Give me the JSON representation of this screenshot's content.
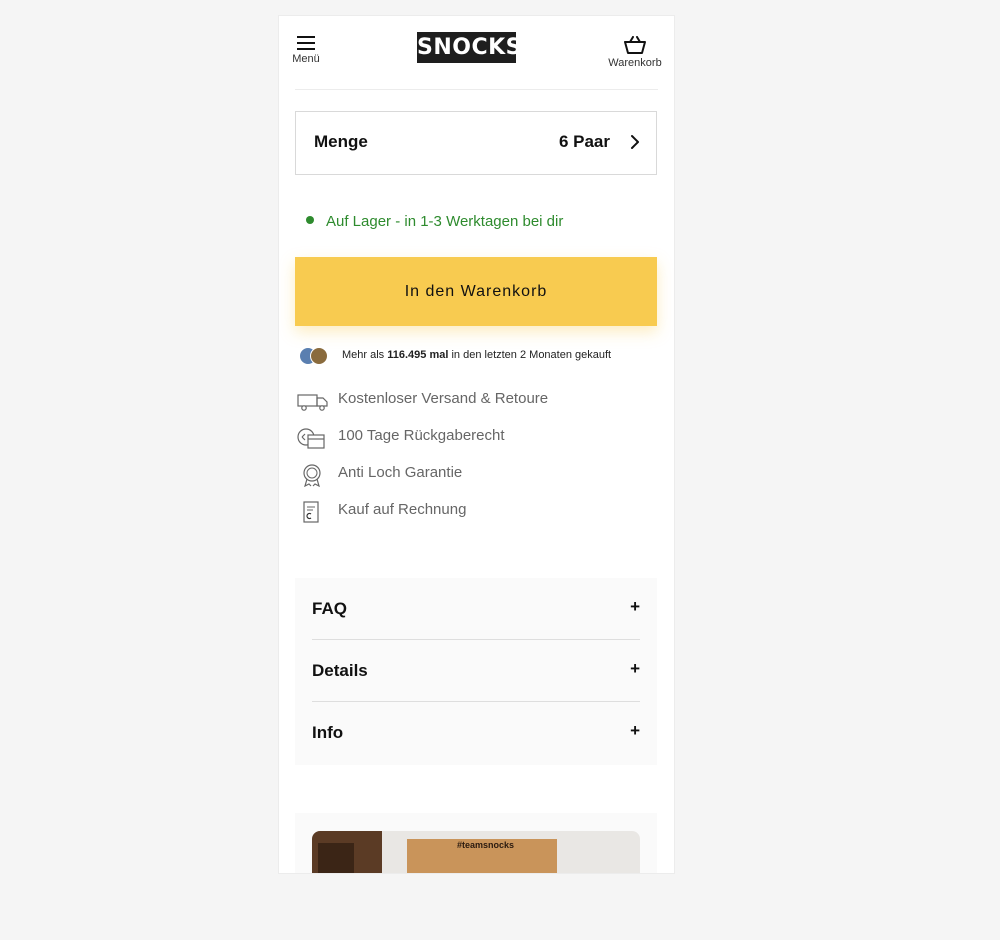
{
  "header": {
    "menu_label": "Menü",
    "logo_text": "SNOCKS",
    "cart_label": "Warenkorb"
  },
  "quantity": {
    "label": "Menge",
    "value": "6 Paar"
  },
  "stock": {
    "text": "Auf Lager - in 1-3 Werktagen bei dir",
    "color": "#2e8b2e"
  },
  "cta": {
    "label": "In den Warenkorb",
    "color": "#f8cb50"
  },
  "social_proof": {
    "prefix": "Mehr als",
    "count": "116.495 mal",
    "suffix": "in den letzten 2 Monaten gekauft"
  },
  "benefits": [
    {
      "icon": "truck-icon",
      "text": "Kostenloser Versand & Retoure"
    },
    {
      "icon": "return-calendar-icon",
      "text": "100 Tage Rückgaberecht"
    },
    {
      "icon": "award-badge-icon",
      "text": "Anti Loch Garantie"
    },
    {
      "icon": "invoice-icon",
      "text": "Kauf auf Rechnung"
    }
  ],
  "accordion": [
    {
      "title": "FAQ",
      "toggle": "+"
    },
    {
      "title": "Details",
      "toggle": "+"
    },
    {
      "title": "Info",
      "toggle": "+"
    }
  ],
  "promo": {
    "image_tag": "#teamsnocks"
  }
}
